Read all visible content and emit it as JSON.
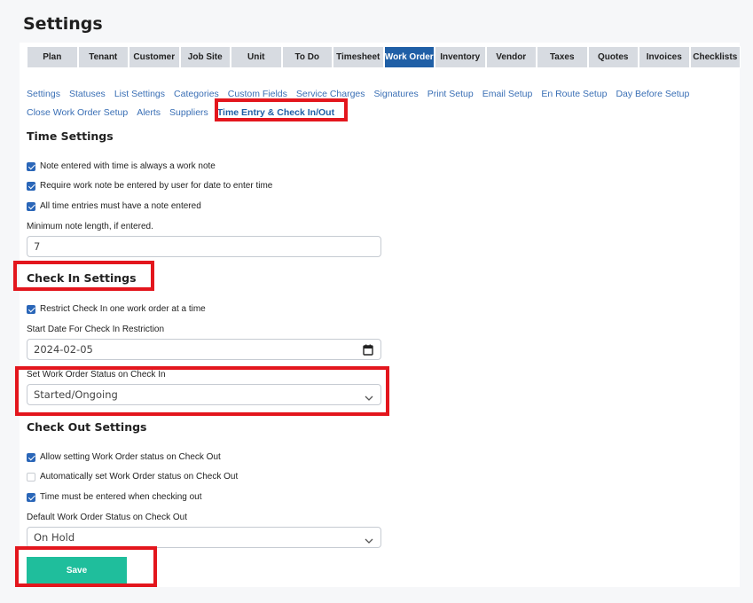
{
  "page": {
    "title": "Settings"
  },
  "tabs": [
    {
      "label": "Plan",
      "active": false
    },
    {
      "label": "Tenant",
      "active": false
    },
    {
      "label": "Customer",
      "active": false
    },
    {
      "label": "Job Site",
      "active": false
    },
    {
      "label": "Unit",
      "active": false
    },
    {
      "label": "To Do",
      "active": false
    },
    {
      "label": "Timesheet",
      "active": false
    },
    {
      "label": "Work Order",
      "active": true
    },
    {
      "label": "Inventory",
      "active": false
    },
    {
      "label": "Vendor",
      "active": false
    },
    {
      "label": "Taxes",
      "active": false
    },
    {
      "label": "Quotes",
      "active": false
    },
    {
      "label": "Invoices",
      "active": false
    },
    {
      "label": "Checklists",
      "active": false
    }
  ],
  "subnav": [
    "Settings",
    "Statuses",
    "List Settings",
    "Categories",
    "Custom Fields",
    "Service Charges",
    "Signatures",
    "Print Setup",
    "Email Setup",
    "En Route Setup",
    "Day Before Setup",
    "Close Work Order Setup",
    "Alerts",
    "Suppliers",
    "Time Entry & Check In/Out"
  ],
  "time_settings": {
    "title": "Time Settings",
    "options": [
      {
        "label": "Note entered with time is always a work note",
        "checked": true
      },
      {
        "label": "Require work note be entered by user for date to enter time",
        "checked": true
      },
      {
        "label": "All time entries must have a note entered",
        "checked": true
      }
    ],
    "min_note_label": "Minimum note length, if entered.",
    "min_note_value": "7"
  },
  "check_in": {
    "title": "Check In Settings",
    "restrict_label": "Restrict Check In one work order at a time",
    "restrict_checked": true,
    "start_date_label": "Start Date For Check In Restriction",
    "start_date_value": "2024-02-05",
    "status_label": "Set Work Order Status on Check In",
    "status_value": "Started/Ongoing"
  },
  "check_out": {
    "title": "Check Out Settings",
    "options": [
      {
        "label": "Allow setting Work Order status on Check Out",
        "checked": true
      },
      {
        "label": "Automatically set Work Order status on Check Out",
        "checked": false
      },
      {
        "label": "Time must be entered when checking out",
        "checked": true
      }
    ],
    "default_status_label": "Default Work Order Status on Check Out",
    "default_status_value": "On Hold"
  },
  "actions": {
    "save_label": "Save"
  },
  "colors": {
    "active_tab": "#1f5fa6",
    "link": "#3a6fb5",
    "save": "#1fbe9c",
    "highlight": "#e3161d"
  },
  "icons": [
    "calendar-icon",
    "chevron-down-icon",
    "checkbox-checked-icon"
  ]
}
